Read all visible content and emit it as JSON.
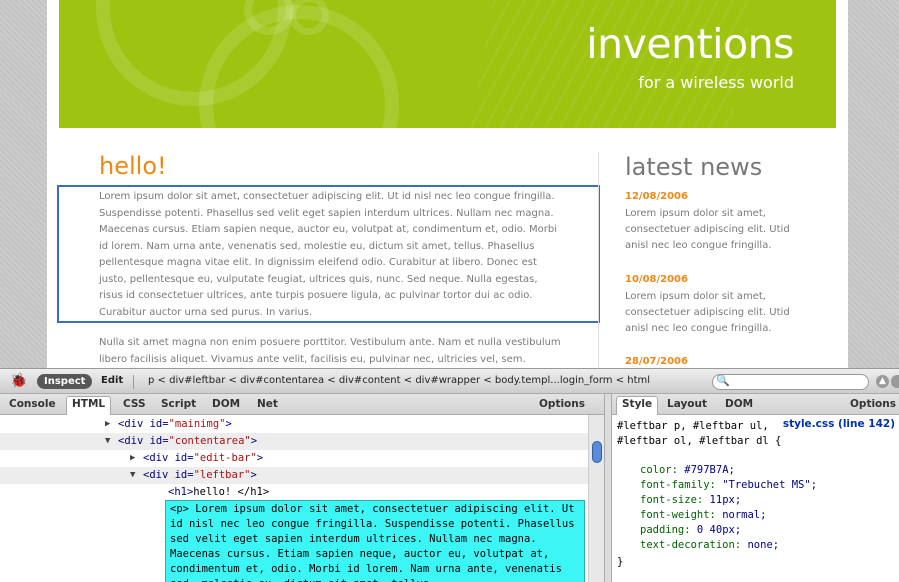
{
  "page": {
    "site_title": "inventions",
    "site_subtitle": "for a wireless world",
    "heading": "hello!",
    "paragraph1": "Lorem ipsum dolor sit amet, consectetuer adipiscing elit. Ut id nisl nec leo congue fringilla. Suspendisse potenti. Phasellus sed velit eget sapien interdum ultrices. Nullam nec magna. Maecenas cursus. Etiam sapien neque, auctor eu, volutpat at, condimentum et, odio. Morbi id lorem. Nam urna ante, venenatis sed, molestie eu, dictum sit amet, tellus. Phasellus pellentesque magna vitae elit. In dignissim eleifend odio. Curabitur at libero. Donec est justo, pellentesque eu, vulputate feugiat, ultrices quis, nunc. Sed neque. Nulla egestas, risus id consectetuer ultrices, ante turpis posuere ligula, ac pulvinar tortor dui ac odio. Curabitur auctor urna sed purus. In varius.",
    "paragraph2": "Nulla sit amet magna non enim posuere porttitor. Vestibulum ante. Nam et nulla vestibulum libero facilisis aliquet. Vivamus ante velit, facilisis eu, pulvinar nec, ultricies vel, sem.",
    "news_title": "latest news",
    "news": [
      {
        "date": "12/08/2006",
        "text": "Lorem ipsum dolor sit amet, consectetuer adipiscing elit. Utid anisl nec leo congue fringilla."
      },
      {
        "date": "10/08/2006",
        "text": "Lorem ipsum dolor sit amet, consectetuer adipiscing elit. Utid anisl nec leo congue fringilla."
      },
      {
        "date": "28/07/2006",
        "text": ""
      }
    ],
    "colors": {
      "banner": "#9ec411",
      "accent": "#f08814",
      "text": "#797b7a"
    }
  },
  "firebug": {
    "inspect_label": "Inspect",
    "edit_label": "Edit",
    "breadcrumbs": [
      "p",
      "div#leftbar",
      "div#contentarea",
      "div#content",
      "div#wrapper",
      "body.templ...login_form",
      "html"
    ],
    "breadcrumb_sep": "<",
    "search_placeholder": "",
    "tabs": [
      "Console",
      "HTML",
      "CSS",
      "Script",
      "DOM",
      "Net"
    ],
    "active_tab": "HTML",
    "options_label": "Options",
    "right_tabs": [
      "Style",
      "Layout",
      "DOM"
    ],
    "right_active_tab": "Style",
    "right_options_label": "Options",
    "tree": [
      {
        "twisty": "▶",
        "open": "<div ",
        "attr": "id=",
        "val": "\"mainimg\"",
        "close": ">"
      },
      {
        "twisty": "▼",
        "open": "<div ",
        "attr": "id=",
        "val": "\"contentarea\"",
        "close": ">"
      },
      {
        "twisty": "▶",
        "open": "<div ",
        "attr": "id=",
        "val": "\"edit-bar\"",
        "close": ">"
      },
      {
        "twisty": "▼",
        "open": "<div ",
        "attr": "id=",
        "val": "\"leftbar\"",
        "close": ">"
      },
      {
        "twisty": "",
        "open": "<h1>",
        "attr": "",
        "val": "",
        "close": "hello! </h1>"
      }
    ],
    "selected_html": "<p> Lorem ipsum dolor sit amet, consectetuer adipiscing elit. Ut id nisl nec leo congue fringilla. Suspendisse potenti. Phasellus sed velit eget sapien interdum ultrices. Nullam nec magna. Maecenas cursus. Etiam sapien neque, auctor eu, volutpat at, condimentum et, odio. Morbi id lorem. Nam urna ante, venenatis sed, molestie eu, dictum sit amet, tellus.",
    "style": {
      "source_link": "style.css (line 142)",
      "selector": "#leftbar p, #leftbar ul, #leftbar ol, #leftbar dl {",
      "declarations": [
        {
          "prop": "color:",
          "value": "#797B7A;"
        },
        {
          "prop": "font-family:",
          "value": "\"Trebuchet MS\";"
        },
        {
          "prop": "font-size:",
          "value": "11px;"
        },
        {
          "prop": "font-weight:",
          "value": "normal;"
        },
        {
          "prop": "padding:",
          "value": "0 40px;"
        },
        {
          "prop": "text-decoration:",
          "value": "none;"
        }
      ],
      "close_brace": "}"
    }
  }
}
